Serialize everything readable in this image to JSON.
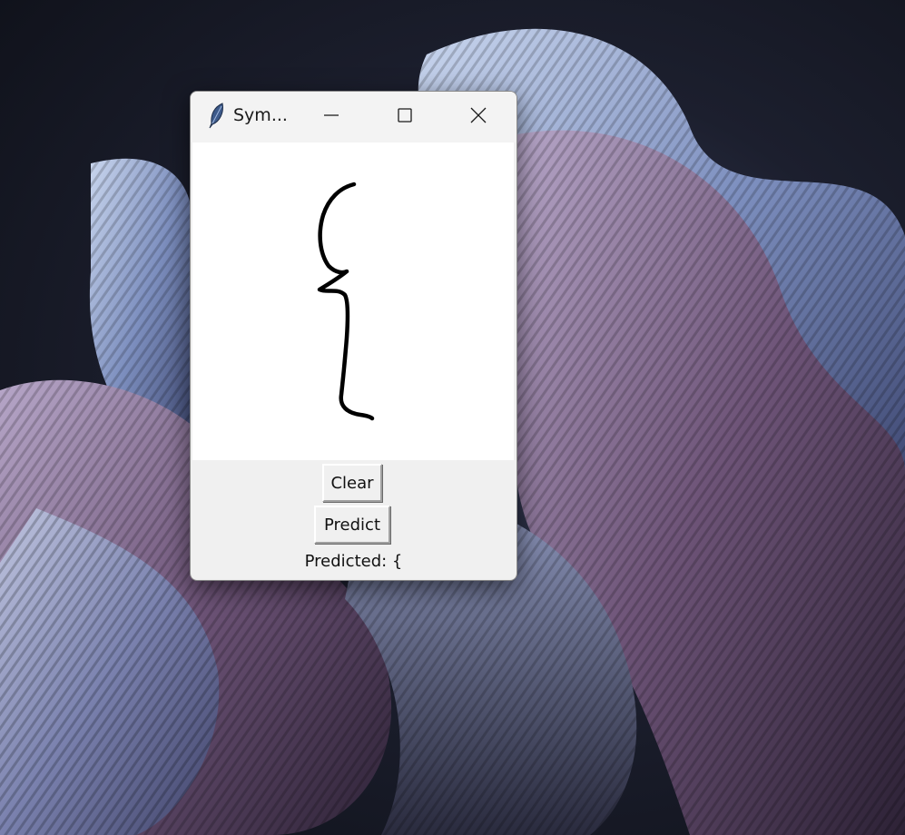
{
  "window": {
    "title": "Sym...",
    "app_icon": "feather-icon",
    "controls": {
      "minimize": "minimize-icon",
      "maximize": "maximize-icon",
      "close": "close-icon"
    }
  },
  "canvas": {
    "background": "#ffffff",
    "stroke_color": "#000000"
  },
  "buttons": {
    "clear_label": "Clear",
    "predict_label": "Predict"
  },
  "prediction": {
    "text": "Predicted: {"
  },
  "desktop": {
    "wallpaper": "abstract-ribbon-wallpaper"
  }
}
